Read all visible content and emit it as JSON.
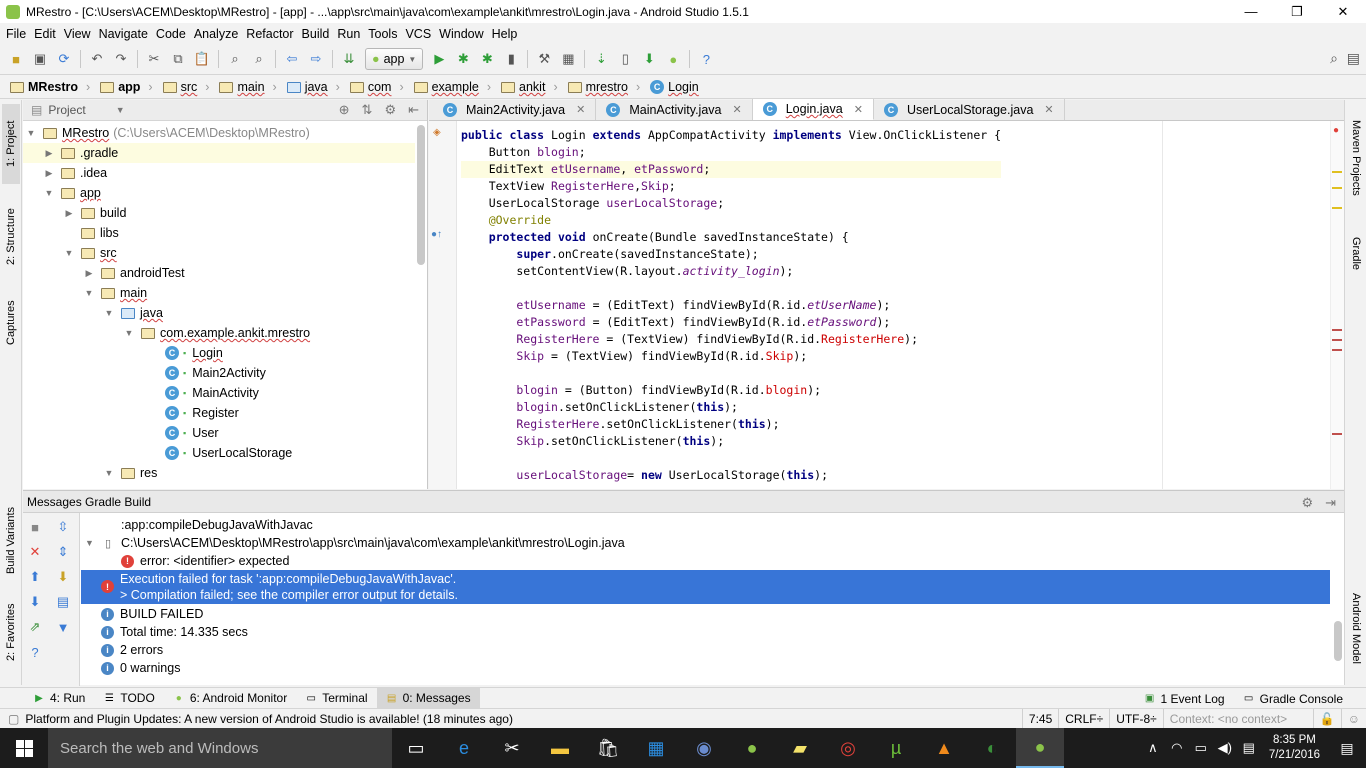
{
  "window": {
    "title": "MRestro - [C:\\Users\\ACEM\\Desktop\\MRestro] - [app] - ...\\app\\src\\main\\java\\com\\example\\ankit\\mrestro\\Login.java - Android Studio 1.5.1",
    "minimize": "—",
    "maximize": "❐",
    "close": "✕"
  },
  "menu": [
    "File",
    "Edit",
    "View",
    "Navigate",
    "Code",
    "Analyze",
    "Refactor",
    "Build",
    "Run",
    "Tools",
    "VCS",
    "Window",
    "Help"
  ],
  "toolbar": {
    "run_config": "app"
  },
  "breadcrumb": [
    "MRestro",
    "app",
    "src",
    "main",
    "java",
    "com",
    "example",
    "ankit",
    "mrestro",
    "Login"
  ],
  "left_tool_windows": [
    "1: Project",
    "2: Structure",
    "Captures",
    "Build Variants",
    "2: Favorites"
  ],
  "right_tool_windows": [
    "Maven Projects",
    "Gradle",
    "Android Model"
  ],
  "project": {
    "header": "Project",
    "tree": [
      {
        "label": "MRestro",
        "extra": "(C:\\Users\\ACEM\\Desktop\\MRestro)"
      },
      {
        "label": ".gradle"
      },
      {
        "label": ".idea"
      },
      {
        "label": "app"
      },
      {
        "label": "build"
      },
      {
        "label": "libs"
      },
      {
        "label": "src"
      },
      {
        "label": "androidTest"
      },
      {
        "label": "main"
      },
      {
        "label": "java"
      },
      {
        "label": "com.example.ankit.mrestro"
      },
      {
        "label": "Login"
      },
      {
        "label": "Main2Activity"
      },
      {
        "label": "MainActivity"
      },
      {
        "label": "Register"
      },
      {
        "label": "User"
      },
      {
        "label": "UserLocalStorage"
      },
      {
        "label": "res"
      }
    ]
  },
  "editor": {
    "tabs": [
      "Main2Activity.java",
      "MainActivity.java",
      "Login.java",
      "UserLocalStorage.java"
    ],
    "active_tab": "Login.java",
    "code": {
      "l1": {
        "a": "public class ",
        "b": "Login ",
        "c": "extends ",
        "d": "AppCompatActivity ",
        "e": "implements ",
        "f": "View.OnClickListener {"
      },
      "l2": {
        "a": "    Button ",
        "b": "blogin",
        "c": ";"
      },
      "l3": {
        "a": "    EditText ",
        "b": "etUsername",
        "c": ", ",
        "d": "etPassword",
        "e": ";"
      },
      "l4": {
        "a": "    TextView ",
        "b": "RegisterHere",
        "c": ",",
        "d": "Skip",
        "e": ";"
      },
      "l5": {
        "a": "    UserLocalStorage ",
        "b": "userLocalStorage",
        "c": ";"
      },
      "l6": {
        "a": "    @Override"
      },
      "l7": {
        "a": "    ",
        "b": "protected void ",
        "c": "onCreate(Bundle savedInstanceState) {"
      },
      "l8": {
        "a": "        ",
        "b": "super",
        "c": ".onCreate(savedInstanceState);"
      },
      "l9": {
        "a": "        setContentView(R.layout.",
        "b": "activity_login",
        "c": ");"
      },
      "l11": {
        "a": "        ",
        "b": "etUsername",
        "c": " = (EditText) findViewById(R.id.",
        "d": "etUserName",
        "e": ");"
      },
      "l12": {
        "a": "        ",
        "b": "etPassword",
        "c": " = (EditText) findViewById(R.id.",
        "d": "etPassword",
        "e": ");"
      },
      "l13": {
        "a": "        ",
        "b": "RegisterHere",
        "c": " = (TextView) findViewById(R.id.",
        "d": "RegisterHere",
        "e": ");"
      },
      "l14": {
        "a": "        ",
        "b": "Skip",
        "c": " = (TextView) findViewById(R.id.",
        "d": "Skip",
        "e": ");"
      },
      "l16": {
        "a": "        ",
        "b": "blogin",
        "c": " = (Button) findViewById(R.id.",
        "d": "blogin",
        "e": ");"
      },
      "l17": {
        "a": "        ",
        "b": "blogin",
        "c": ".setOnClickListener(",
        "d": "this",
        "e": ");"
      },
      "l18": {
        "a": "        ",
        "b": "RegisterHere",
        "c": ".setOnClickListener(",
        "d": "this",
        "e": ");"
      },
      "l19": {
        "a": "        ",
        "b": "Skip",
        "c": ".setOnClickListener(",
        "d": "this",
        "e": ");"
      },
      "l21": {
        "a": "        ",
        "b": "userLocalStorage",
        "c": "= ",
        "d": "new ",
        "e": "UserLocalStorage(",
        "f": "this",
        "g": ");"
      }
    }
  },
  "messages": {
    "header": "Messages Gradle Build",
    "rows": [
      {
        "text": ":app:compileDebugJavaWithJavac"
      },
      {
        "text": "C:\\Users\\ACEM\\Desktop\\MRestro\\app\\src\\main\\java\\com\\example\\ankit\\mrestro\\Login.java"
      },
      {
        "text": "error: <identifier> expected"
      },
      {
        "text": "Execution failed for task ':app:compileDebugJavaWithJavac'.",
        "text2": "> Compilation failed; see the compiler error output for details."
      },
      {
        "text": "BUILD FAILED"
      },
      {
        "text": "Total time: 14.335 secs"
      },
      {
        "text": "2 errors"
      },
      {
        "text": "0 warnings"
      }
    ]
  },
  "bottom_tabs": {
    "run": "4: Run",
    "todo": "TODO",
    "monitor": "6: Android Monitor",
    "terminal": "Terminal",
    "messages": "0: Messages",
    "event_log": "1 Event Log",
    "gradle_console": "Gradle Console"
  },
  "status": {
    "message": "Platform and Plugin Updates: A new version of Android Studio is available! (18 minutes ago)",
    "position": "7:45",
    "line_sep": "CRLF÷",
    "encoding": "UTF-8÷",
    "context": "Context: <no context>"
  },
  "taskbar": {
    "search_placeholder": "Search the web and Windows",
    "time": "8:35 PM",
    "date": "7/21/2016"
  },
  "colors": {
    "accent_selection": "#3875d7",
    "keyword": "#000080",
    "field": "#660e7a",
    "error": "#e0413a"
  }
}
